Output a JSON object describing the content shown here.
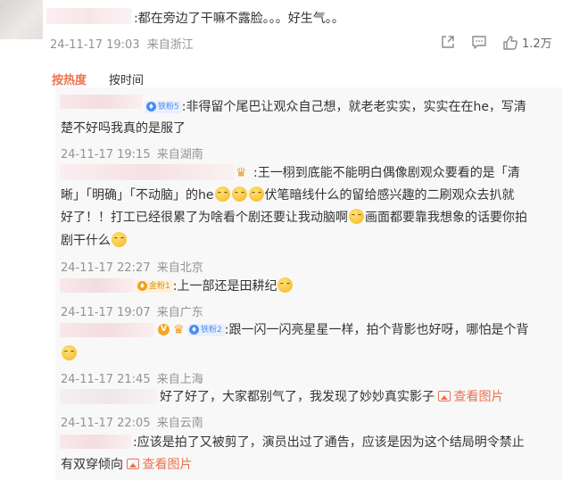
{
  "main_comment": {
    "text": ":都在旁边了干嘛不露脸。。。好生气。。",
    "time": "24-11-17 19:03",
    "location": "来自浙江",
    "like_count": "1.2万"
  },
  "tabs": [
    {
      "label": "按热度",
      "active": true
    },
    {
      "label": "按时间",
      "active": false
    }
  ],
  "replies": [
    {
      "badge": "铁粉5",
      "text_line1": ":非得留个尾巴让观众自己想，就老老实实，实实在在he，写清",
      "text_line2": "楚不好吗我真的是服了",
      "time": "24-11-17 19:15",
      "location": "来自湖南"
    },
    {
      "part1": ":王一栩到底能不能明白偶像剧观众要看的是「清",
      "part2": "晰」「明确」「不动脑」的he",
      "part3": "伏笔暗线什么的留给感兴趣的二刷观众去扒就",
      "part4": "好了！！打工已经很累了为啥看个剧还要让我动脑啊",
      "part5": "画面都要靠我想象的话要你拍",
      "part6": "剧干什么",
      "time": "24-11-17 22:27",
      "location": "来自北京"
    },
    {
      "badge": "金粉1",
      "text": ":上一部还是田耕纪",
      "time": "24-11-17 19:07",
      "location": "来自广东"
    },
    {
      "badge_v": "V",
      "badge": "铁粉2",
      "text": ":跟一闪一闪亮星星一样，拍个背影也好呀，哪怕是个背",
      "time": "24-11-17 21:45",
      "location": "来自上海"
    },
    {
      "text": "好了好了，大家都别气了，我发现了妙妙真实影子",
      "link": "查看图片",
      "time": "24-11-17 22:05",
      "location": "来自云南"
    },
    {
      "text_line1": ":应该是拍了又被剪了，演员出过了通告，应该是因为这个结局明令禁止",
      "text_line2": "有双穿倾向",
      "link": "查看图片"
    }
  ],
  "icons": {
    "share": "share-icon",
    "comment": "comment-icon",
    "like": "thumbs-up-icon",
    "view_image": "image-icon",
    "emoji": "smile-emoji-icon"
  },
  "colors": {
    "active_tab": "#eb7350",
    "link": "#eb7350",
    "meta": "#939393",
    "badge_blue": "#4a8df0",
    "badge_gold": "#f0a020",
    "reply_bg": "#f8f8f8"
  }
}
